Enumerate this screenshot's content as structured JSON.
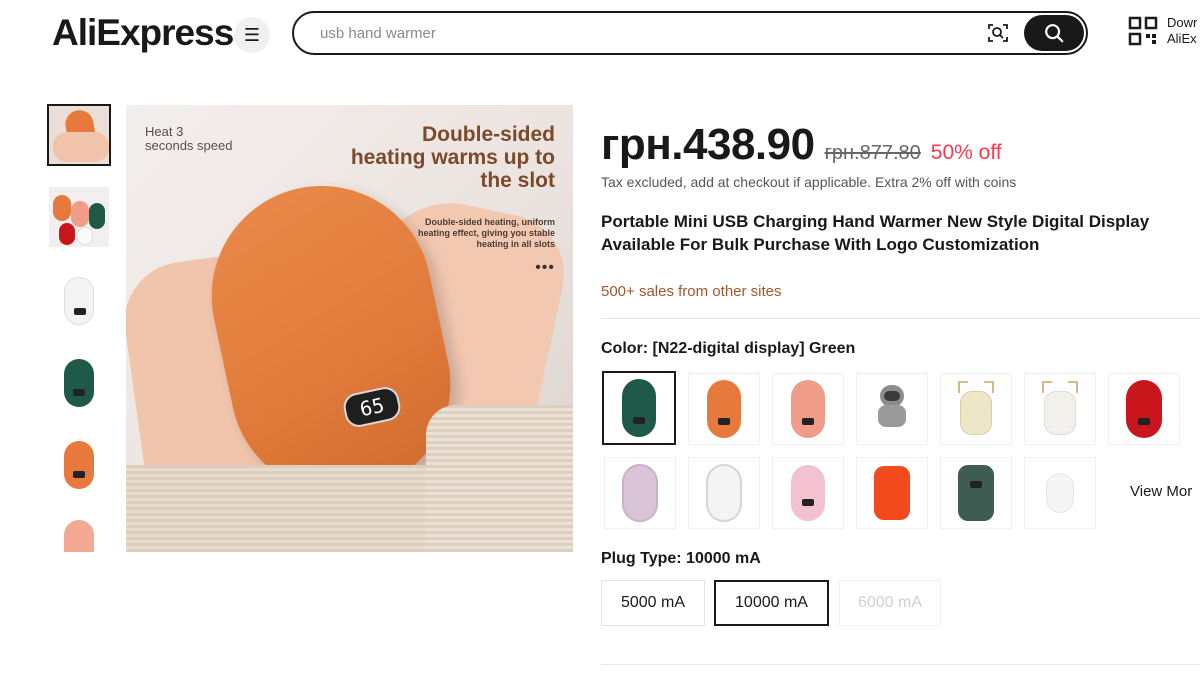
{
  "header": {
    "logo_text": "AliExpress",
    "menu_icon": "hamburger-icon",
    "search": {
      "placeholder": "usb hand warmer",
      "value": ""
    },
    "download_line1": "Dowr",
    "download_line2": "AliEx"
  },
  "gallery": {
    "main_image": {
      "heat_text_line1": "Heat 3",
      "heat_text_line2": "seconds speed",
      "headline_line1": "Double-sided",
      "headline_line2": "heating warms up to",
      "headline_line3": "the slot",
      "subtext_line1": "Double-sided heating, uniform",
      "subtext_line2": "heating effect, giving you stable",
      "subtext_line3": "heating in all slots",
      "display_value": "65",
      "dots": "•••"
    },
    "thumbnail_colors": [
      "#e8793d",
      "multi",
      "#f4f4f4",
      "#1f5a48",
      "#e8793d",
      "#f3a891"
    ]
  },
  "product": {
    "price": "грн.438.90",
    "old_price": "грн.877.80",
    "discount": "50% off",
    "tax_note": "Tax excluded, add at checkout if applicable. Extra 2% off with coins",
    "title": "Portable Mini USB Charging Hand Warmer New Style Digital Display Available For Bulk Purchase With Logo Customization",
    "sales": "500+ sales from other sites",
    "color_label": "Color: [N22-digital display] Green",
    "colors": [
      {
        "name": "green",
        "hex": "#1f5a48",
        "selected": true
      },
      {
        "name": "orange",
        "hex": "#e8793d"
      },
      {
        "name": "pink",
        "hex": "#ef9d8a"
      },
      {
        "name": "astronaut-gray",
        "hex": "#8c8c8c"
      },
      {
        "name": "deer-cream",
        "hex": "#efe6c8"
      },
      {
        "name": "deer-white",
        "hex": "#f2f0ea"
      },
      {
        "name": "red",
        "hex": "#c9161c"
      },
      {
        "name": "lavender",
        "hex": "#d8c4d6"
      },
      {
        "name": "white-silver",
        "hex": "#f4f4f4"
      },
      {
        "name": "light-pink",
        "hex": "#f2c2d0"
      },
      {
        "name": "bright-orange",
        "hex": "#f24a1c"
      },
      {
        "name": "dark-green",
        "hex": "#3f5c52"
      },
      {
        "name": "white",
        "hex": "#f5f5f5"
      }
    ],
    "view_more": "View Mor",
    "plug_label": "Plug Type: 10000 mA",
    "plug_options": [
      {
        "label": "5000 mA",
        "state": "normal"
      },
      {
        "label": "10000 mA",
        "state": "selected"
      },
      {
        "label": "6000 mA",
        "state": "disabled"
      }
    ]
  }
}
